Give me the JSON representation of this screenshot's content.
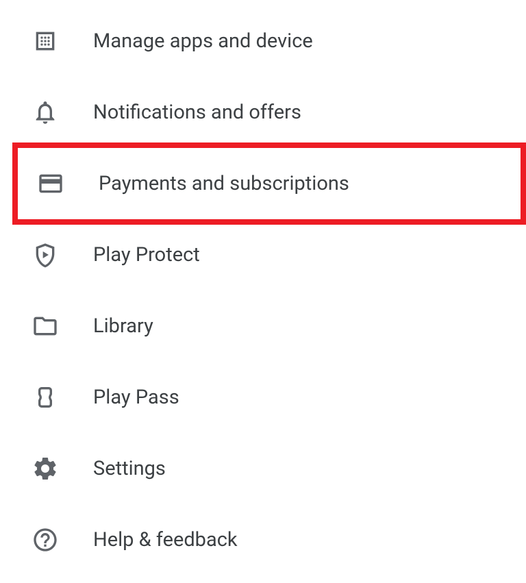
{
  "menu": {
    "items": [
      {
        "label": "Manage apps and device"
      },
      {
        "label": "Notifications and offers"
      },
      {
        "label": "Payments and subscriptions"
      },
      {
        "label": "Play Protect"
      },
      {
        "label": "Library"
      },
      {
        "label": "Play Pass"
      },
      {
        "label": "Settings"
      },
      {
        "label": "Help & feedback"
      }
    ]
  },
  "highlight": {
    "color": "#ed1c24"
  }
}
